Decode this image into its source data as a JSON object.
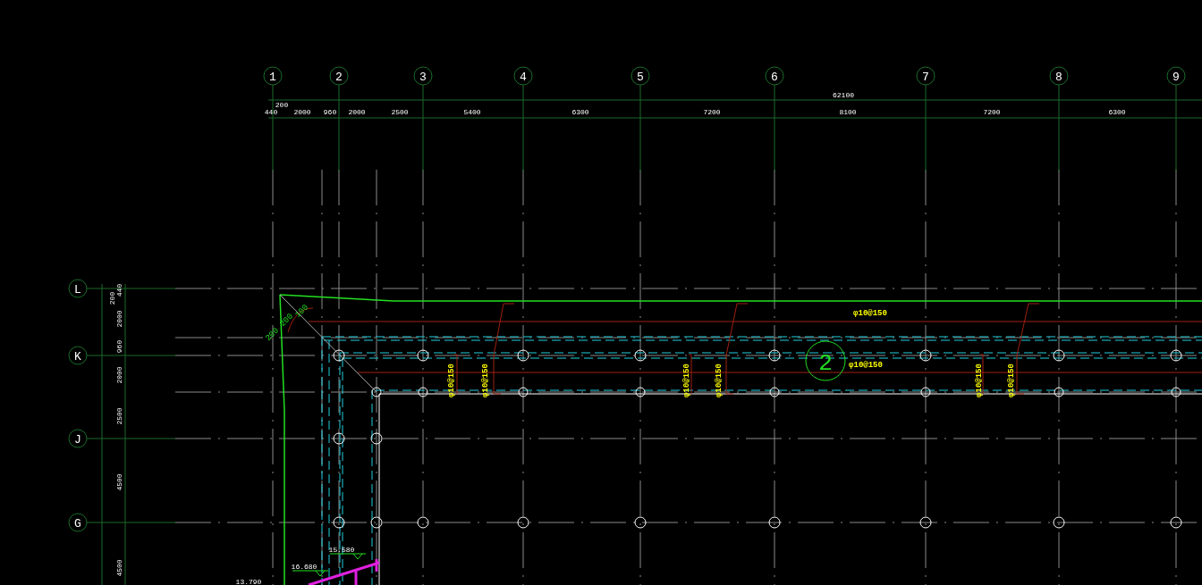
{
  "column_axes": [
    "1",
    "2",
    "3",
    "4",
    "5",
    "6",
    "7",
    "8",
    "9"
  ],
  "row_axes": [
    "L",
    "K",
    "J",
    "G"
  ],
  "overall_dimension": "62100",
  "column_dimensions": [
    "440",
    "200",
    "2000",
    "960",
    "2000",
    "2500",
    "5400",
    "6300",
    "7200",
    "8100",
    "7200",
    "6300"
  ],
  "row_dimensions": [
    "440",
    "200",
    "2000",
    "960",
    "2000",
    "2500",
    "4500",
    "4500"
  ],
  "rebar_annotations": [
    "φ10@150",
    "φ10@150",
    "φ10@150",
    "φ10@150",
    "φ10@150",
    "φ10@150",
    "φ10@150",
    "φ10@150"
  ],
  "corner_annotations": [
    "200",
    "200",
    "100"
  ],
  "section_mark": "2",
  "elevations": [
    "16.680",
    "15.580",
    "13.790"
  ]
}
